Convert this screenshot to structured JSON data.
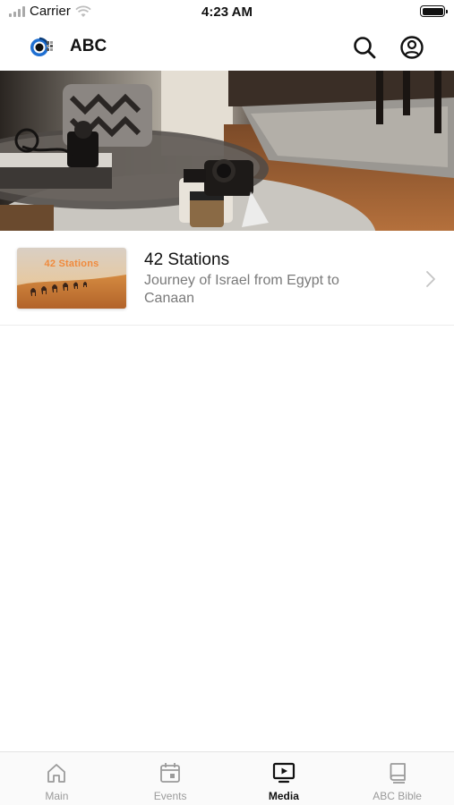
{
  "status_bar": {
    "carrier": "Carrier",
    "time": "4:23 AM"
  },
  "header": {
    "title": "ABC",
    "icons": [
      "logo",
      "search-icon",
      "account-icon"
    ]
  },
  "list": [
    {
      "thumbnail_text": "42 Stations",
      "title": "42 Stations",
      "subtitle": "Journey of Israel from Egypt to Canaan"
    }
  ],
  "tabs": [
    {
      "label": "Main",
      "icon": "home-icon",
      "active": false
    },
    {
      "label": "Events",
      "icon": "calendar-icon",
      "active": false
    },
    {
      "label": "Media",
      "icon": "play-screen-icon",
      "active": true
    },
    {
      "label": "ABC Bible",
      "icon": "book-icon",
      "active": false
    }
  ],
  "colors": {
    "accent_active": "#111111",
    "tab_inactive": "#9a9a9a",
    "subtitle": "#7a7a7a",
    "logo_blue": "#1f6fd1",
    "thumb_text": "#f08a3c"
  }
}
